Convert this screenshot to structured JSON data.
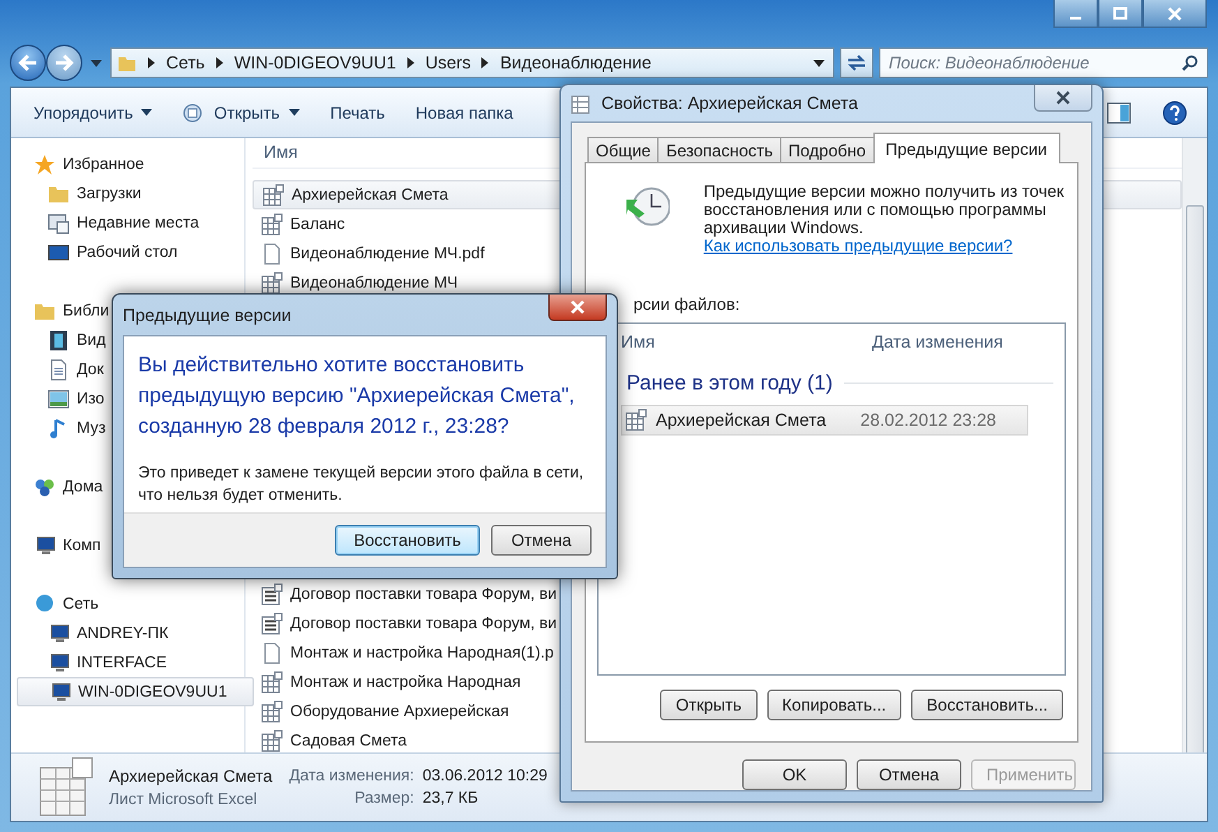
{
  "explorer": {
    "breadcrumbs": [
      "Сеть",
      "WIN-0DIGEOV9UU1",
      "Users",
      "Видеонаблюдение"
    ],
    "search": {
      "placeholder": "Поиск: Видеонаблюдение"
    },
    "toolbar": [
      {
        "label": "Упорядочить",
        "kind": "menu"
      },
      {
        "label": "Открыть",
        "kind": "open"
      },
      {
        "label": "Печать",
        "kind": "plain"
      },
      {
        "label": "Новая папка",
        "kind": "plain"
      }
    ],
    "sidebar": [
      {
        "label": "Избранное",
        "kind": "star",
        "selected": false,
        "children": [
          {
            "label": "Загрузки",
            "kind": "downloads",
            "selected": false
          },
          {
            "label": "Недавние места",
            "kind": "recent",
            "selected": false
          },
          {
            "label": "Рабочий стол",
            "kind": "desktop",
            "selected": false
          }
        ]
      },
      {
        "label": "Библи",
        "kind": "library",
        "selected": false,
        "children": [
          {
            "label": "Вид",
            "kind": "video",
            "selected": false
          },
          {
            "label": "Док",
            "kind": "document",
            "selected": false
          },
          {
            "label": "Изо",
            "kind": "image",
            "selected": false
          },
          {
            "label": "Муз",
            "kind": "music",
            "selected": false
          }
        ]
      },
      {
        "label": "Дома",
        "kind": "homegroup",
        "selected": false
      },
      {
        "label": "Комп",
        "kind": "computer",
        "selected": false
      },
      {
        "label": "Сеть",
        "kind": "network",
        "selected": false,
        "children": [
          {
            "label": "ANDREY-ПК",
            "kind": "computer",
            "selected": false
          },
          {
            "label": "INTERFACE",
            "kind": "computer",
            "selected": false
          },
          {
            "label": "WIN-0DIGEOV9UU1",
            "kind": "computer",
            "selected": true
          }
        ]
      }
    ],
    "column": "Имя",
    "files_above": [
      {
        "name": "Архиерейская Смета",
        "kind": "spreadsheet",
        "selected": true
      },
      {
        "name": "Баланс",
        "kind": "spreadsheet",
        "selected": false
      },
      {
        "name": "Видеонаблюдение МЧ.pdf",
        "kind": "blank",
        "selected": false
      },
      {
        "name": "Видеонаблюдение МЧ",
        "kind": "spreadsheet",
        "selected": false
      }
    ],
    "files_below": [
      {
        "name": "Договор поставки товара Форум, ви",
        "kind": "form",
        "selected": false
      },
      {
        "name": "Договор поставки товара Форум, ви",
        "kind": "form",
        "selected": false
      },
      {
        "name": "Монтаж и настройка Народная(1).р",
        "kind": "blank",
        "selected": false
      },
      {
        "name": "Монтаж и настройка Народная",
        "kind": "spreadsheet",
        "selected": false
      },
      {
        "name": "Оборудование Архиерейская",
        "kind": "spreadsheet",
        "selected": false
      },
      {
        "name": "Садовая Смета",
        "kind": "spreadsheet",
        "selected": false
      }
    ],
    "details": {
      "name": "Архиерейская Смета",
      "type": "Лист Microsoft Excel",
      "fields": [
        {
          "label": "Дата изменения:",
          "value": "03.06.2012 10:29"
        },
        {
          "label": "Размер:",
          "value": "23,7 КБ"
        }
      ]
    }
  },
  "properties": {
    "title": "Свойства: Архиерейская Смета",
    "tabs": [
      {
        "label": "Общие",
        "selected": false
      },
      {
        "label": "Безопасность",
        "selected": false
      },
      {
        "label": "Подробно",
        "selected": false
      },
      {
        "label": "Предыдущие версии",
        "selected": true
      }
    ],
    "info": "Предыдущие версии можно получить из точек восстановления или с помощью программы архивации Windows.",
    "link": "Как использовать предыдущие версии?",
    "versions_label": "рсии файлов:",
    "columns": [
      "Имя",
      "Дата изменения"
    ],
    "group": "Ранее в этом году (1)",
    "rows": [
      {
        "name": "Архиерейская Смета",
        "date": "28.02.2012 23:28",
        "selected": true
      }
    ],
    "actions": [
      "Открыть",
      "Копировать...",
      "Восстановить..."
    ],
    "footer": [
      {
        "label": "OK",
        "disabled": false
      },
      {
        "label": "Отмена",
        "disabled": false
      },
      {
        "label": "Применить",
        "disabled": true
      }
    ]
  },
  "confirm": {
    "title": "Предыдущие версии",
    "question": "Вы действительно хотите восстановить предыдущую версию \"Архиерейская Смета\", созданную 28 февраля 2012 г., 23:28?",
    "note": "Это приведет к замене текущей версии этого файла в сети, что нельзя будет отменить.",
    "buttons": [
      {
        "label": "Восстановить",
        "default": true
      },
      {
        "label": "Отмена",
        "default": false
      }
    ]
  }
}
